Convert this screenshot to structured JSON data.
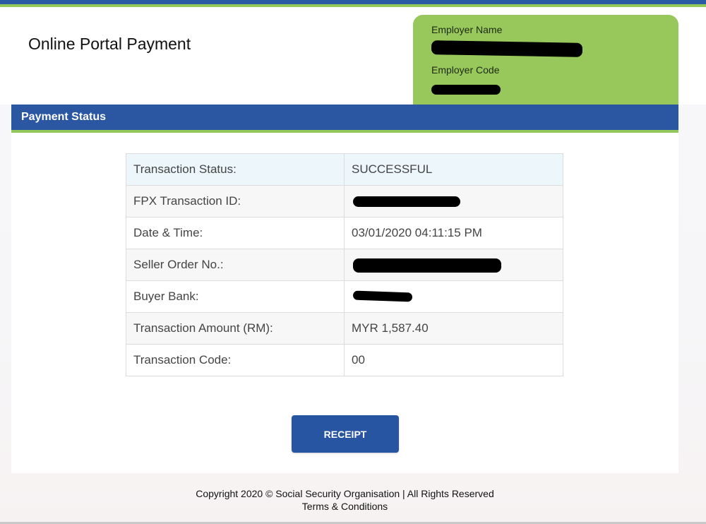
{
  "header": {
    "title": "Online Portal Payment",
    "employer_name_label": "Employer Name",
    "employer_code_label": "Employer Code",
    "colors": {
      "blue": "#2a59a6",
      "green": "#95c85b"
    }
  },
  "section": {
    "title": "Payment Status"
  },
  "details": [
    {
      "label": "Transaction Status:",
      "value": "SUCCESSFUL"
    },
    {
      "label": "FPX Transaction ID:",
      "value": ""
    },
    {
      "label": "Date & Time:",
      "value": "03/01/2020 04:11:15 PM"
    },
    {
      "label": "Seller Order No.:",
      "value": ""
    },
    {
      "label": "Buyer Bank:",
      "value": ""
    },
    {
      "label": "Transaction Amount (RM):",
      "value": "MYR 1,587.40"
    },
    {
      "label": "Transaction Code:",
      "value": "00"
    }
  ],
  "actions": {
    "receipt_label": "RECEIPT"
  },
  "footer": {
    "copyright": "Copyright 2020 © Social Security Organisation | All Rights Reserved",
    "terms": "Terms & Conditions"
  }
}
